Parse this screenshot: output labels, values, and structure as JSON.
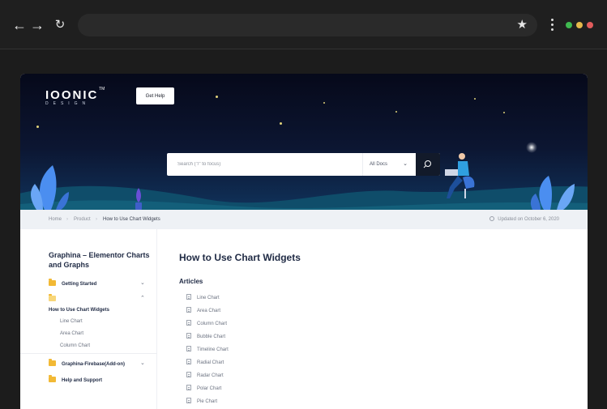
{
  "browser": {
    "back_icon": "arrow-left-icon",
    "forward_icon": "arrow-right-icon",
    "reload_icon": "reload-icon",
    "bookmark_icon": "star-icon",
    "menu_icon": "kebab-menu-icon",
    "window_dots": [
      "#3fb950",
      "#e5b84a",
      "#e25c5c"
    ]
  },
  "header": {
    "logo_main": "IOONIC",
    "logo_sub": "DESIGN",
    "logo_tm": "TM",
    "help_button": "Get Help"
  },
  "search": {
    "placeholder": "Search (\"/\" to focus)",
    "scope": "All Docs",
    "button_icon": "search-icon"
  },
  "breadcrumb": {
    "items": [
      "Home",
      "Product",
      "How to Use Chart Widgets"
    ],
    "updated": "Updated on October 6, 2020"
  },
  "sidebar": {
    "title": "Graphina – Elementor Charts and Graphs",
    "items": [
      {
        "label": "Getting Started"
      },
      {
        "label": "How to Use Chart Widgets",
        "children": [
          "Line Chart",
          "Area Chart",
          "Column Chart"
        ]
      },
      {
        "label": "Graphina-Firebase(Add-on)"
      },
      {
        "label": "Help and Support"
      }
    ]
  },
  "main": {
    "title": "How to Use Chart Widgets",
    "articles_label": "Articles",
    "articles": [
      "Line Chart",
      "Area Chart",
      "Column Chart",
      "Bubble Chart",
      "Timeline Chart",
      "Radial Chart",
      "Radar Chart",
      "Polar Chart",
      "Pie Chart"
    ]
  }
}
